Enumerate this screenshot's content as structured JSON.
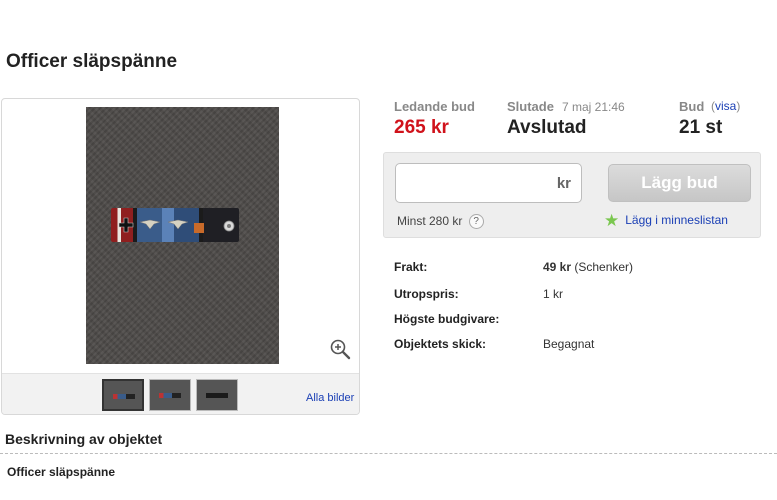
{
  "item": {
    "title": "Officer släpspänne"
  },
  "gallery": {
    "all_images_label": "Alla bilder",
    "thumbnail_count": 3
  },
  "bid_summary": {
    "leading_bid_label": "Ledande bud",
    "leading_bid_value": "265 kr",
    "ended_label": "Slutade",
    "ended_date": "7 maj 21:46",
    "status_value": "Avslutad",
    "bids_label": "Bud",
    "bids_link_open": "(",
    "bids_link": "visa",
    "bids_link_close": ")",
    "bids_value": "21 st"
  },
  "bid_form": {
    "input_value": "",
    "currency_suffix": "kr",
    "button_label": "Lägg bud",
    "min_bid_text": "Minst 280 kr",
    "help_glyph": "?",
    "watchlist_label": "Lägg i minneslistan"
  },
  "details": [
    {
      "key": "Frakt:",
      "value_bold": "49 kr",
      "value": " (Schenker)"
    },
    {
      "key": "Utropspris:",
      "value_bold": "",
      "value": "1 kr"
    },
    {
      "key": "Högste budgivare:",
      "value_bold": "",
      "value": ""
    },
    {
      "key": "Objektets skick:",
      "value_bold": "",
      "value": "Begagnat"
    }
  ],
  "description": {
    "heading": "Beskrivning av objektet",
    "body": "Officer släpspänne"
  },
  "colors": {
    "price_red": "#d0121b",
    "link_blue": "#1a3fb5",
    "button_disabled": "#cfcfcf",
    "star_green": "#7ac74f"
  },
  "icons": [
    "zoom-in-icon",
    "help-icon",
    "star-icon"
  ]
}
